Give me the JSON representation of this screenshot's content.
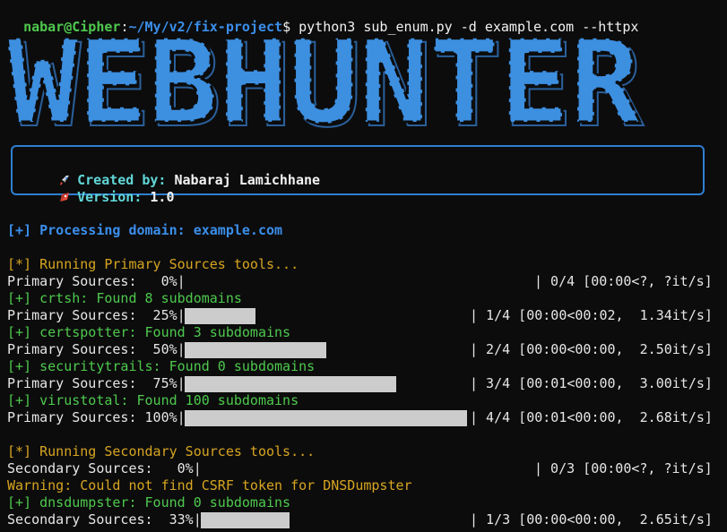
{
  "prompt": {
    "user_host": "nabar@Cipher",
    "separator": ":",
    "path": "~/My/v2/fix-project",
    "symbol": "$",
    "command": " python3 sub_enum.py -d example.com --httpx"
  },
  "banner": {
    "text": "WEBHUNTER"
  },
  "info": {
    "created_label": "Created by:",
    "created_value": "Nabaraj Lamichhane",
    "version_label": "Version:",
    "version_value": "1.0"
  },
  "processing": {
    "label": "[+] Processing domain:",
    "domain": "example.com"
  },
  "primary": {
    "header": "[*] Running Primary Sources tools...",
    "rows": [
      {
        "label": "Primary Sources:   0%|",
        "stats": "| 0/4 [00:00<?, ?it/s]",
        "progress": 0
      },
      {
        "label": "Primary Sources:  25%|",
        "stats": "| 1/4 [00:00<00:02,  1.34it/s]",
        "progress": 0.25
      },
      {
        "label": "Primary Sources:  50%|",
        "stats": "| 2/4 [00:00<00:00,  2.50it/s]",
        "progress": 0.5
      },
      {
        "label": "Primary Sources:  75%|",
        "stats": "| 3/4 [00:01<00:00,  3.00it/s]",
        "progress": 0.75
      },
      {
        "label": "Primary Sources: 100%|",
        "stats": "| 4/4 [00:01<00:00,  2.68it/s]",
        "progress": 1.0
      }
    ],
    "found": [
      "[+] crtsh: Found 8 subdomains",
      "[+] certspotter: Found 3 subdomains",
      "[+] securitytrails: Found 0 subdomains",
      "[+] virustotal: Found 100 subdomains"
    ]
  },
  "secondary": {
    "header": "[*] Running Secondary Sources tools...",
    "rows": [
      {
        "label": "Secondary Sources:   0%|",
        "stats": "| 0/3 [00:00<?, ?it/s]",
        "progress": 0
      },
      {
        "label": "Secondary Sources:  33%|",
        "stats": "| 1/3 [00:00<00:00,  2.65it/s]",
        "progress": 0.33
      }
    ],
    "warning": "Warning: Could not find CSRF token for DNSDumpster",
    "found": [
      "[+] dnsdumpster: Found 0 subdomains"
    ]
  },
  "colors": {
    "green": "#4ec94e",
    "blue": "#3b8eea",
    "yellow": "#d7a521",
    "cyan": "#61d6d6",
    "bar": "#cccccc"
  },
  "icons": [
    "rocket-icon"
  ]
}
